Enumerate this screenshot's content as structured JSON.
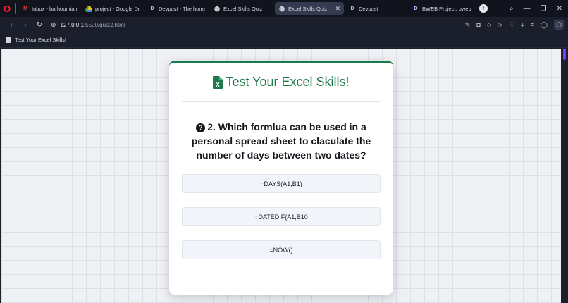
{
  "browser": {
    "tabs": [
      {
        "label": "Inbox - barhoumiamina",
        "favicon": "gmail-icon",
        "active": false
      },
      {
        "label": "project - Google Drive",
        "favicon": "drive-icon",
        "active": false
      },
      {
        "label": "Devpost - The home fo",
        "favicon": "devpost-icon",
        "active": false
      },
      {
        "label": "Excel Skills Quiz",
        "favicon": "globe-icon",
        "active": false
      },
      {
        "label": "Excel Skills Quiz",
        "favicon": "globe-icon",
        "active": true
      },
      {
        "label": "Devpost",
        "favicon": "devpost-icon",
        "active": false
      },
      {
        "label": "BWEB Project: bweb pr",
        "favicon": "devpost-icon",
        "active": false
      }
    ],
    "url_host": "127.0.0.1",
    "url_path": ":5500/quiz2.html",
    "page_title": "Test Your Excel Skills!"
  },
  "quiz": {
    "title": "Test Your Excel Skills!",
    "question": "2. Which formlua can be used in a personal spread sheet to claculate the number of days between two dates?",
    "options": [
      "=DAYS(A1,B1)",
      "=DATEDIF(A1,B10",
      "=NOW()"
    ]
  },
  "colors": {
    "accent": "#1e7a4a",
    "opera": "#ff1b2d",
    "sidebar_accent": "#7b3cff"
  }
}
